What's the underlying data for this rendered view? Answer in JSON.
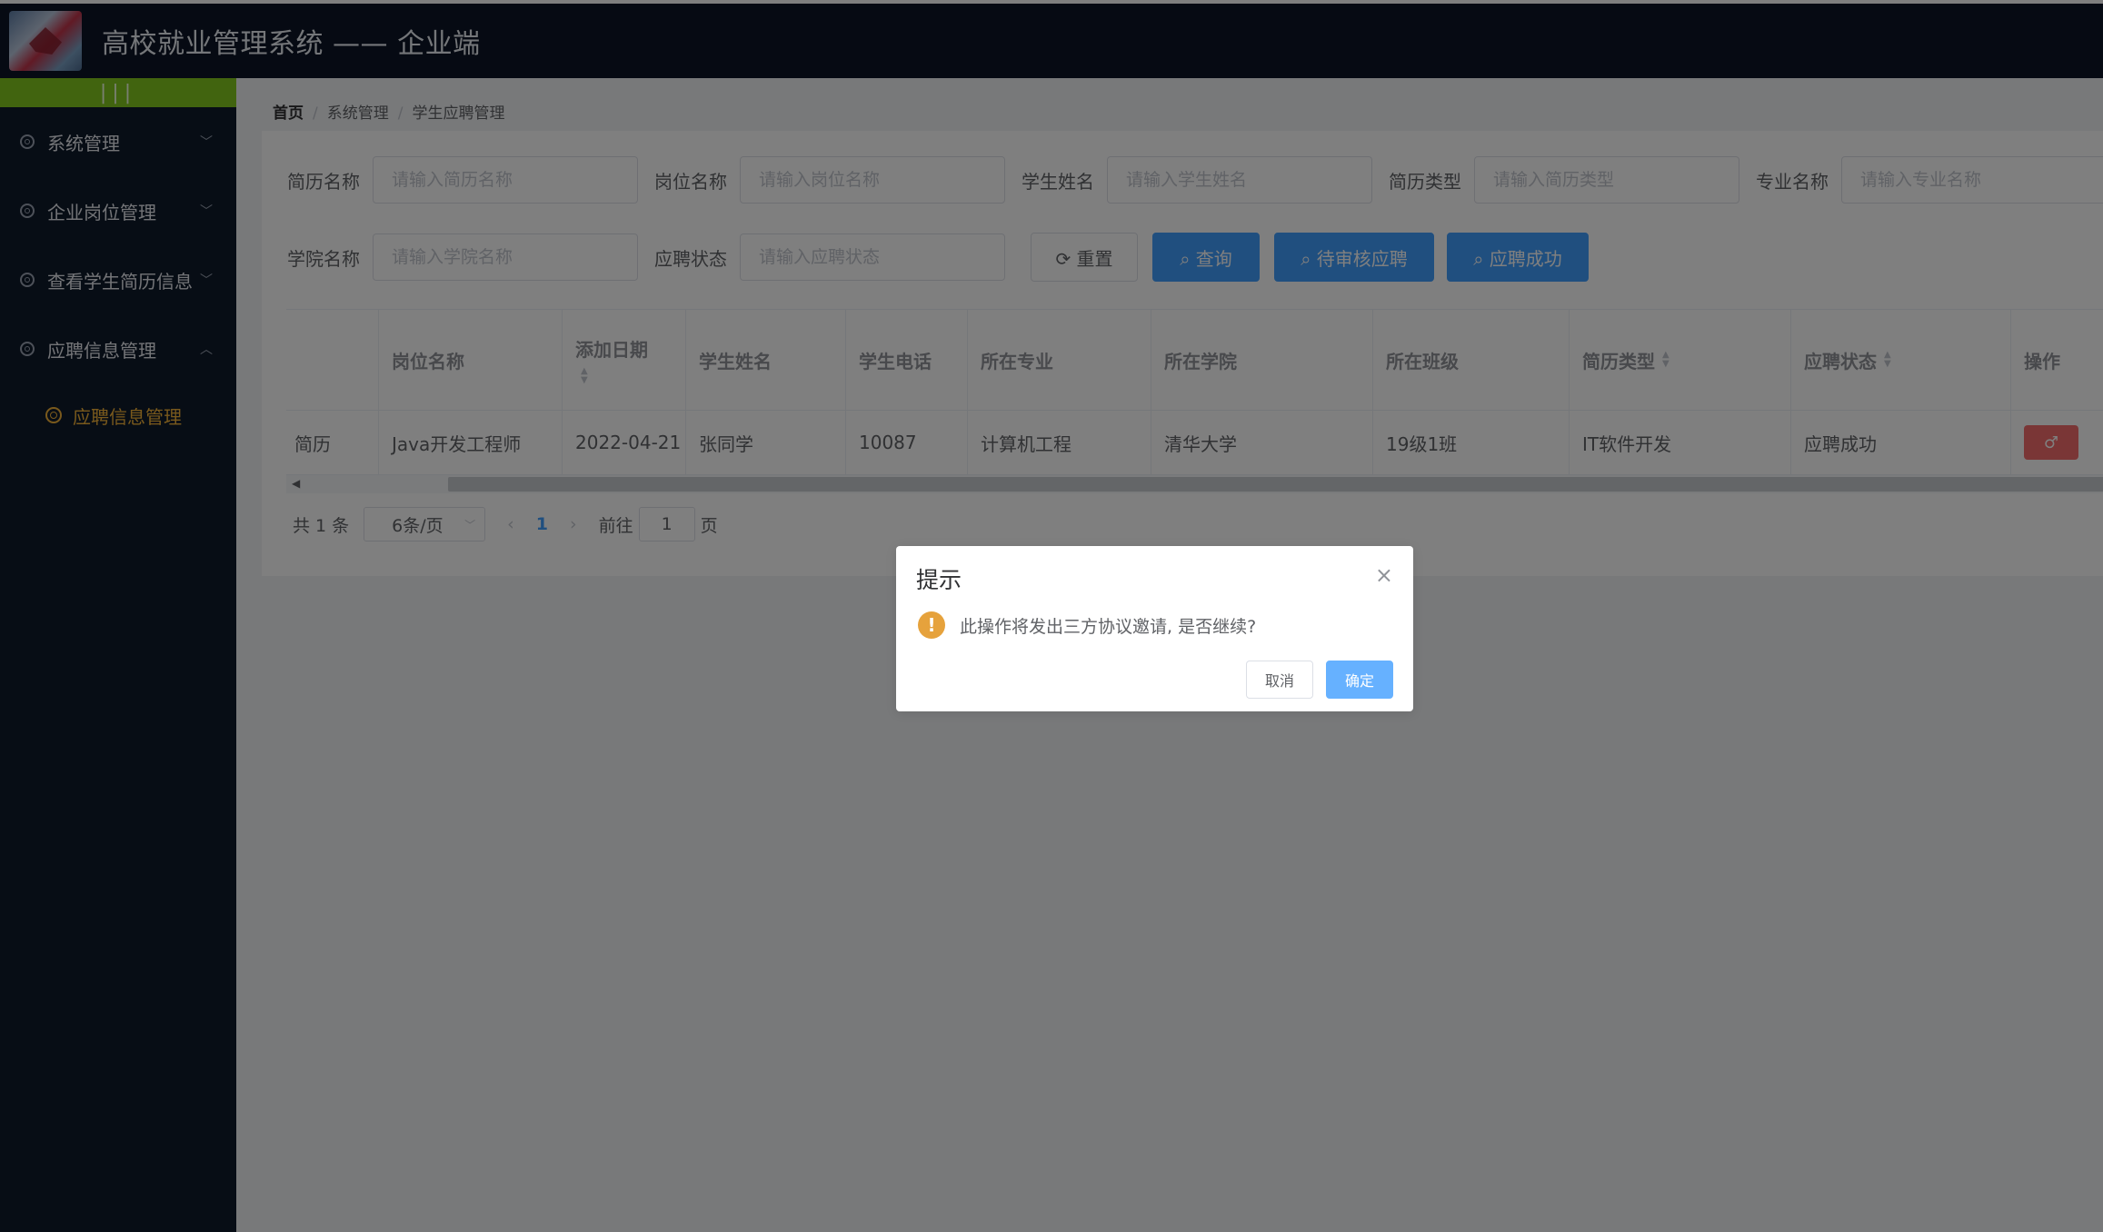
{
  "header": {
    "title": "高校就业管理系统 —— 企业端",
    "logo": "school-logo"
  },
  "sidebar": {
    "collapse_icon": "|||",
    "items": [
      {
        "label": "系统管理",
        "icon": "gear-icon",
        "chevron": "﹀"
      },
      {
        "label": "企业岗位管理",
        "icon": "gear-icon",
        "chevron": "﹀"
      },
      {
        "label": "查看学生简历信息",
        "icon": "gear-icon",
        "chevron": "﹀"
      },
      {
        "label": "应聘信息管理",
        "icon": "gear-icon",
        "chevron": "︿"
      }
    ],
    "sub_items": [
      {
        "label": "应聘信息管理",
        "icon": "circle-icon"
      }
    ]
  },
  "breadcrumb": {
    "items": [
      "首页",
      "系统管理",
      "学生应聘管理"
    ],
    "separator": "/"
  },
  "filters": {
    "resume_name": {
      "label": "简历名称",
      "placeholder": "请输入简历名称"
    },
    "post_name": {
      "label": "岗位名称",
      "placeholder": "请输入岗位名称"
    },
    "student_name": {
      "label": "学生姓名",
      "placeholder": "请输入学生姓名"
    },
    "resume_type": {
      "label": "简历类型",
      "placeholder": "请输入简历类型"
    },
    "major_name": {
      "label": "专业名称",
      "placeholder": "请输入专业名称"
    },
    "college_name": {
      "label": "学院名称",
      "placeholder": "请输入学院名称"
    },
    "apply_status": {
      "label": "应聘状态",
      "placeholder": "请输入应聘状态"
    }
  },
  "buttons": {
    "reset": "⟳ 重置",
    "query": "⌕ 查询",
    "pending": "⌕ 待审核应聘",
    "success": "⌕ 应聘成功"
  },
  "table": {
    "headers": [
      "",
      "岗位名称",
      "添加日期",
      "学生姓名",
      "学生电话",
      "所在专业",
      "所在学院",
      "所在班级",
      "简历类型",
      "应聘状态",
      "操作"
    ],
    "rows": [
      [
        "简历",
        "Java开发工程师",
        "2022-04-21",
        "张同学",
        "10087",
        "计算机工程",
        "清华大学",
        "19级1班",
        "IT软件开发",
        "应聘成功",
        "♂"
      ]
    ]
  },
  "pagination": {
    "total_text": "共 1 条",
    "page_size": "6条/页",
    "prev": "‹",
    "current": "1",
    "next": "›",
    "goto_label": "前往",
    "goto_value": "1",
    "page_suffix": "页"
  },
  "dialog": {
    "title": "提示",
    "close": "×",
    "message": "此操作将发出三方协议邀请, 是否继续?",
    "icon": "!",
    "cancel": "取消",
    "confirm": "确定"
  },
  "colors": {
    "header_bg": "#0d1526",
    "sidebar_bg": "#0f1a2b",
    "accent_green": "#82c91e",
    "primary": "#409eff",
    "warning": "#e6a23c",
    "danger": "#f56c6c",
    "active_menu": "#f3b339"
  }
}
